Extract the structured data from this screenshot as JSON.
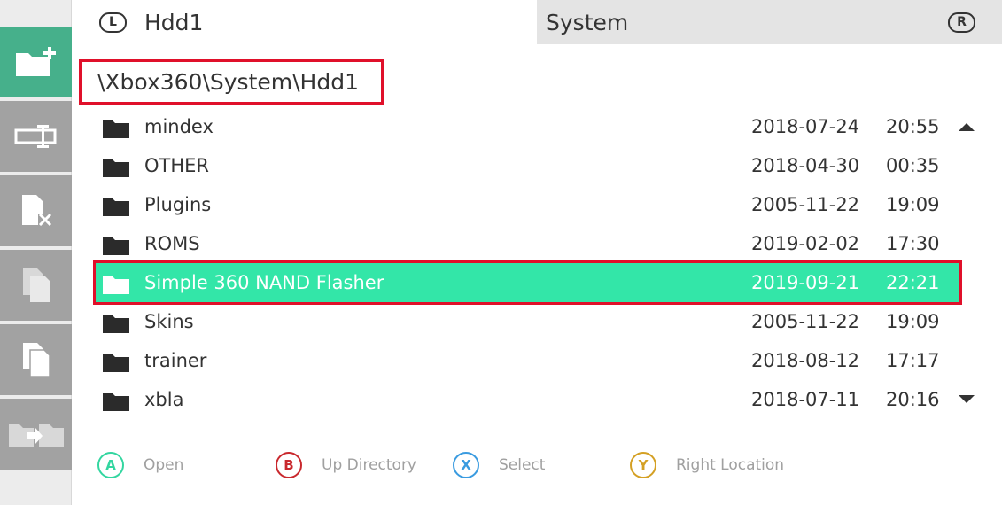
{
  "header": {
    "left_shoulder": "L",
    "left_title": "Hdd1",
    "right_title": "System",
    "right_shoulder": "R"
  },
  "path": "\\Xbox360\\System\\Hdd1",
  "sidebar": {
    "items": [
      {
        "icon": "new-folder-icon",
        "active": true
      },
      {
        "icon": "rename-icon",
        "active": false
      },
      {
        "icon": "delete-file-icon",
        "active": false
      },
      {
        "icon": "copy-icon",
        "active": false
      },
      {
        "icon": "paste-icon",
        "active": false
      },
      {
        "icon": "move-icon",
        "active": false
      }
    ]
  },
  "files": [
    {
      "name": "mindex",
      "date": "2018-07-24",
      "time": "20:55"
    },
    {
      "name": "OTHER",
      "date": "2018-04-30",
      "time": "00:35"
    },
    {
      "name": "Plugins",
      "date": "2005-11-22",
      "time": "19:09"
    },
    {
      "name": "ROMS",
      "date": "2019-02-02",
      "time": "17:30"
    },
    {
      "name": "Simple 360 NAND Flasher",
      "date": "2019-09-21",
      "time": "22:21",
      "selected": true
    },
    {
      "name": "Skins",
      "date": "2005-11-22",
      "time": "19:09"
    },
    {
      "name": "trainer",
      "date": "2018-08-12",
      "time": "17:17"
    },
    {
      "name": "xbla",
      "date": "2018-07-11",
      "time": "20:16"
    }
  ],
  "legend": [
    {
      "button": "A",
      "label": "Open",
      "color": "#33d6a0"
    },
    {
      "button": "B",
      "label": "Up Directory",
      "color": "#c9282d"
    },
    {
      "button": "X",
      "label": "Select",
      "color": "#3a9be0"
    },
    {
      "button": "Y",
      "label": "Right Location",
      "color": "#d4a024"
    }
  ],
  "colors": {
    "accent": "#33e6a8",
    "sidebar_active": "#46b08b",
    "sidebar_button": "#a2a2a2",
    "highlight_border": "#e0102a"
  }
}
